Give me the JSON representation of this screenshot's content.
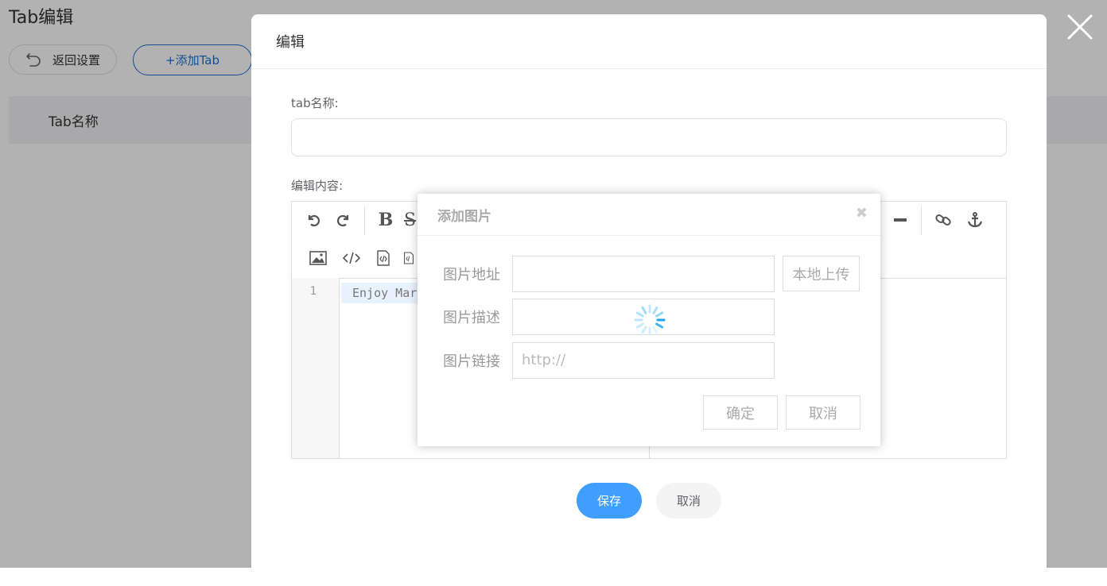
{
  "page": {
    "title": "Tab编辑",
    "back_label": "返回设置",
    "add_label": "+添加Tab",
    "table_header": "Tab名称"
  },
  "edit_dialog": {
    "title": "编辑",
    "tab_name_label": "tab名称:",
    "tab_name_value": "",
    "content_label": "编辑内容:",
    "editor": {
      "line_number": "1",
      "code_text": "Enjoy Mar",
      "toolbar_icons": [
        "undo-icon",
        "redo-icon",
        "bold-icon",
        "strikethrough-icon",
        "hr-icon",
        "link-icon",
        "anchor-icon",
        "image-icon",
        "code-icon",
        "code-block-icon",
        "preformatted-icon"
      ]
    },
    "save_label": "保存",
    "cancel_label": "取消"
  },
  "image_dialog": {
    "title": "添加图片",
    "url_label": "图片地址",
    "url_value": "",
    "upload_label": "本地上传",
    "desc_label": "图片描述",
    "desc_value": "",
    "link_label": "图片链接",
    "link_placeholder": "http://",
    "ok_label": "确定",
    "cancel_label": "取消"
  },
  "colors": {
    "primary": "#409eff",
    "link_blue": "#1f6fd6",
    "spinner": "#1aa3e8"
  }
}
